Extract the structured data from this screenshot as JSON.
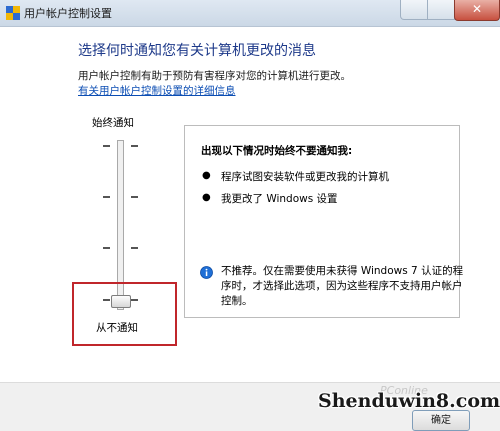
{
  "window": {
    "title": "用户帐户控制设置"
  },
  "content": {
    "heading": "选择何时通知您有关计算机更改的消息",
    "description": "用户帐户控制有助于预防有害程序对您的计算机进行更改。",
    "link": "有关用户帐户控制设置的详细信息"
  },
  "slider": {
    "top_label": "始终通知",
    "bottom_label": "从不通知",
    "levels": 4,
    "selected_level": 1
  },
  "panel": {
    "title": "出现以下情况时始终不要通知我:",
    "bullets": [
      "程序试图安装软件或更改我的计算机",
      "我更改了 Windows 设置"
    ],
    "note_lines": [
      "不推荐。仅在需要使用未获得 Windows 7 认证的程",
      "序时，才选择此选项，因为这些程序不支持用户帐户",
      "控制。"
    ]
  },
  "footer": {
    "ok_label": "确定"
  },
  "watermarks": {
    "site": "Shenduwin8.com",
    "pconline": "PConline"
  },
  "colors": {
    "heading": "#1e3a8a",
    "link": "#0b4db3",
    "highlight_box": "#c0262b",
    "info_icon": "#1f6fd6"
  },
  "icons": {
    "app": "uac-shield-icon",
    "info": "info-icon",
    "bullet": "bullet-dot-icon"
  }
}
